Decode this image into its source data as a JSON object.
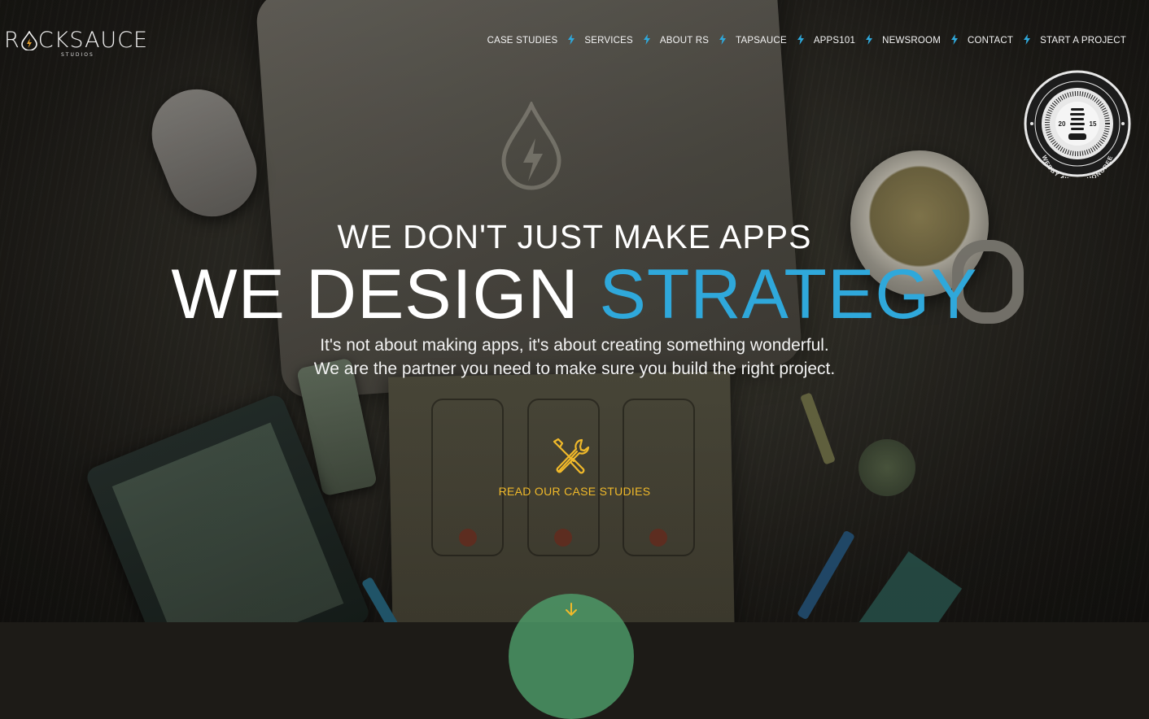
{
  "brand": {
    "name_left": "R",
    "name_right": "CKSAUCE",
    "sub": "STUDIOS",
    "logo_icon": "lightning-drop-icon"
  },
  "nav": {
    "items": [
      {
        "label": "CASE STUDIES"
      },
      {
        "label": "SERVICES"
      },
      {
        "label": "ABOUT RS"
      },
      {
        "label": "TAPSAUCE"
      },
      {
        "label": "APPS101"
      },
      {
        "label": "NEWSROOM"
      },
      {
        "label": "CONTACT"
      },
      {
        "label": "START A PROJECT"
      }
    ],
    "separator_icon": "lightning-bolt-icon"
  },
  "badge": {
    "year_left": "20",
    "year_right": "15",
    "text": "WEBBY AWARD HONOREE"
  },
  "hero": {
    "line1": "WE DON'T JUST MAKE APPS",
    "line2_main": "WE DESIGN ",
    "line2_accent": "STRATEGY",
    "sub_line1": "It's not about making apps, it's about creating something wonderful.",
    "sub_line2": "We are the partner you need to make sure you build the right project."
  },
  "cta": {
    "icon": "wrench-screwdriver-icon",
    "label": "READ OUR CASE STUDIES"
  },
  "scroll": {
    "icon": "arrow-down-icon"
  },
  "colors": {
    "accent_blue": "#2fa8db",
    "cta_yellow": "#f0b92a",
    "scroll_green": "#4f9f6b",
    "logo_orange": "#e8a231"
  }
}
